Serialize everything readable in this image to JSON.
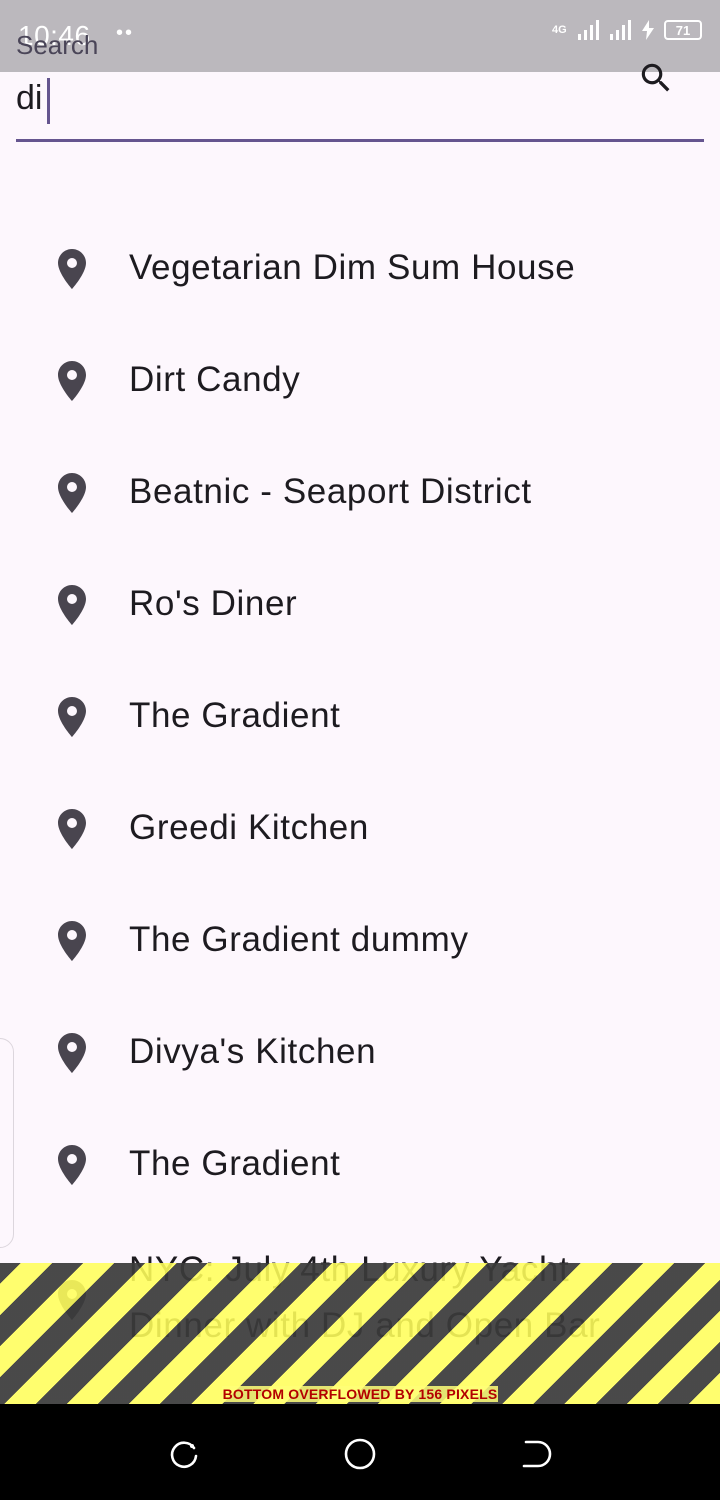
{
  "status_bar": {
    "time": "10:46",
    "dots": "••",
    "network": "4G",
    "battery": "71"
  },
  "search": {
    "label": "Search",
    "value": "di",
    "icon": "search-icon"
  },
  "results": [
    {
      "label": "Vegetarian Dim Sum House",
      "icon": "location-pin-icon"
    },
    {
      "label": "Dirt Candy",
      "icon": "location-pin-icon"
    },
    {
      "label": "Beatnic - Seaport District",
      "icon": "location-pin-icon"
    },
    {
      "label": "Ro's Diner",
      "icon": "location-pin-icon"
    },
    {
      "label": "The Gradient",
      "icon": "location-pin-icon"
    },
    {
      "label": "Greedi Kitchen",
      "icon": "location-pin-icon"
    },
    {
      "label": "The Gradient dummy",
      "icon": "location-pin-icon"
    },
    {
      "label": "Divya's Kitchen",
      "icon": "location-pin-icon"
    },
    {
      "label": "The Gradient",
      "icon": "location-pin-icon"
    },
    {
      "label": "NYC: July 4th Luxury Yacht Dinner with DJ and Open Bar",
      "icon": "location-pin-icon"
    }
  ],
  "overflow_banner": {
    "text": "BOTTOM OVERFLOWED BY 156 PIXELS"
  },
  "colors": {
    "accent": "#65558f",
    "background": "#fdf7fd",
    "pin": "#49454f",
    "status_bar": "#bbb8bd"
  },
  "nav_bar": {
    "icons": [
      "recent-apps-icon",
      "home-icon",
      "back-icon"
    ]
  }
}
